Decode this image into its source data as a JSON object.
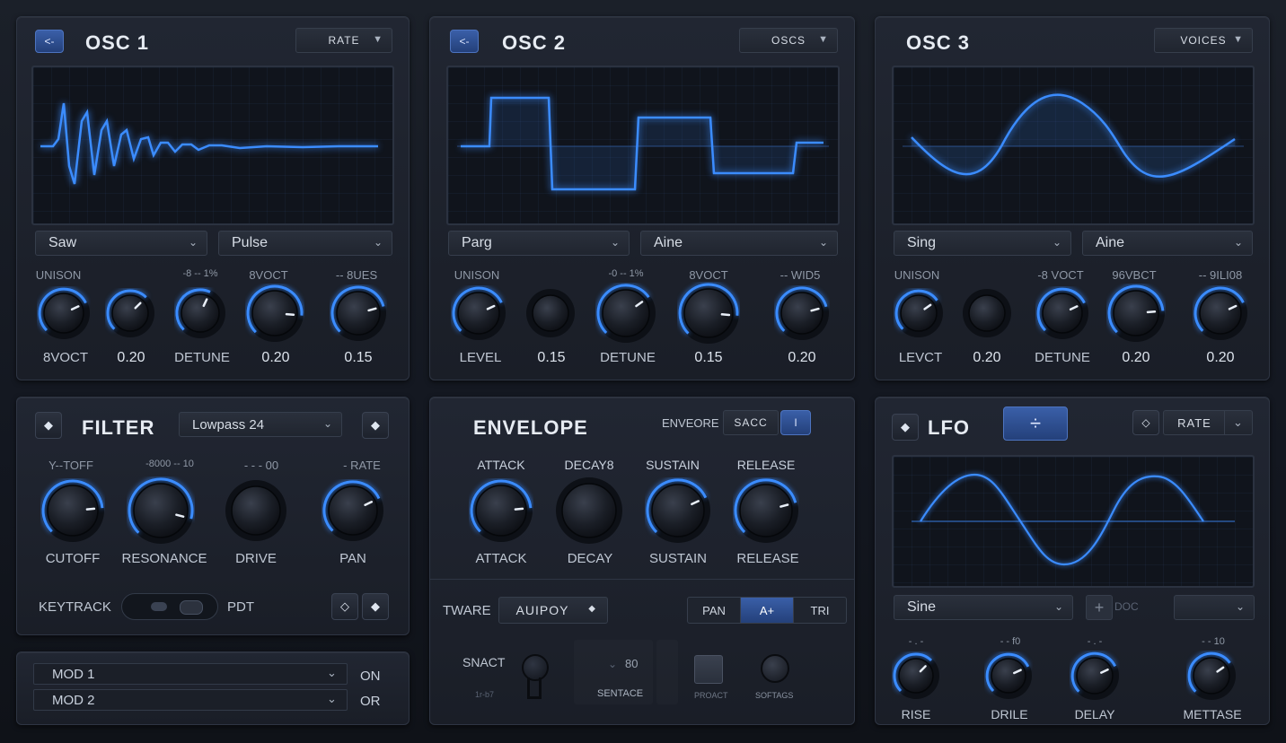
{
  "accent": "#3b8cff",
  "osc": [
    {
      "title": "OSC 1",
      "header_dropdown": "RATE",
      "wave_a": "Saw",
      "wave_b": "Pulse",
      "top_labels": [
        "UNISON",
        "",
        "-8 -- 1%",
        "8VOCT",
        "-- 8UES"
      ],
      "knobs": [
        {
          "label": "8VOCT"
        },
        {
          "label": "0.20"
        },
        {
          "label": "DETUNE"
        },
        {
          "label": "0.20"
        },
        {
          "label": "0.15"
        }
      ]
    },
    {
      "title": "OSC 2",
      "header_dropdown": "OSCS",
      "wave_a": "Parg",
      "wave_b": "Aine",
      "top_labels": [
        "UNISON",
        "",
        "-0 -- 1%",
        "8VOCT",
        "-- WID5"
      ],
      "knobs": [
        {
          "label": "LEVEL"
        },
        {
          "label": "0.15"
        },
        {
          "label": "DETUNE"
        },
        {
          "label": "0.15"
        },
        {
          "label": "0.20"
        }
      ]
    },
    {
      "title": "OSC 3",
      "header_dropdown": "VOICES",
      "wave_a": "Sing",
      "wave_b": "Aine",
      "top_labels": [
        "UNISON",
        "",
        "-8 VOCT",
        "96VBCT",
        "-- 9ILI08"
      ],
      "knobs": [
        {
          "label": "LEVCT"
        },
        {
          "label": "0.20"
        },
        {
          "label": "DETUNE"
        },
        {
          "label": "0.20"
        },
        {
          "label": "0.20"
        }
      ]
    }
  ],
  "filter": {
    "title": "FILTER",
    "type": "Lowpass 24",
    "top_labels": [
      "Y--TOFF",
      "-8000 -- 10",
      "- - - 00",
      "- RATE"
    ],
    "knobs": [
      "CUTOFF",
      "RESONANCE",
      "DRIVE",
      "PAN"
    ],
    "keytrack": "KEYTRACK",
    "pdt": "PDT"
  },
  "mod": [
    {
      "label": "MOD 1",
      "state": "ON"
    },
    {
      "label": "MOD 2",
      "state": "OR"
    }
  ],
  "envelope": {
    "title": "ENVELOPE",
    "mode_label": "ENVEORE",
    "mode_value": "SACC",
    "mode_btn": "I",
    "top_labels": [
      "ATTACK",
      "DECAY8",
      "SUSTAIN",
      "RELEASE"
    ],
    "knobs": [
      "ATTACK",
      "DECAY",
      "SUSTAIN",
      "RELEASE"
    ],
    "tware_label": "TWARE",
    "tware_value": "AUIPOY",
    "seg": [
      "PAN",
      "A+",
      "TRI"
    ],
    "snact": "SNACT",
    "snact_sub": "1r-b7",
    "value80": "80",
    "sentace": "SENTACE",
    "proact": "PROACT",
    "softags": "SOFTAGS"
  },
  "lfo": {
    "title": "LFO",
    "rate": "RATE",
    "wave": "Sine",
    "doc": "DOC",
    "top_labels": [
      "- . -",
      "- - f0",
      "- . -",
      "- - 10"
    ],
    "knobs": [
      "RISE",
      "DRILE",
      "DELAY",
      "METTASE"
    ]
  }
}
